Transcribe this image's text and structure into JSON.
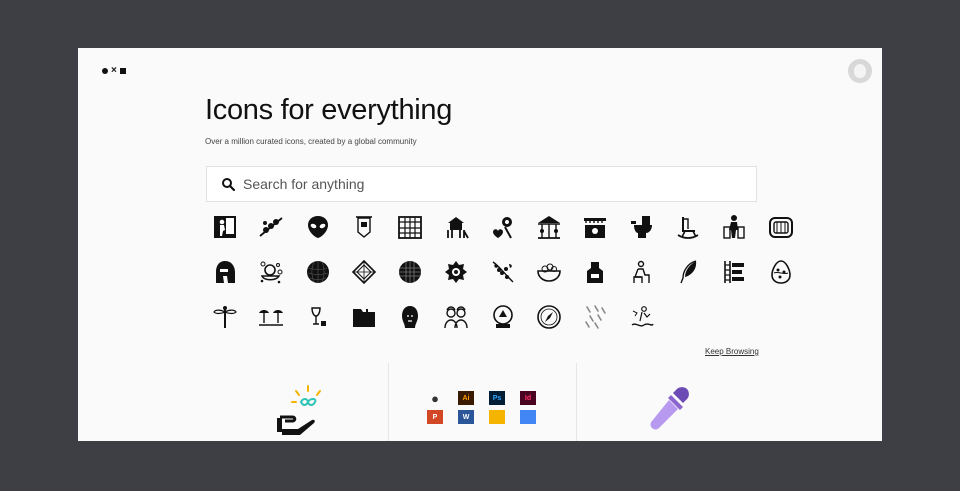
{
  "header": {
    "logo_icon": "dot-times-square-logo",
    "avatar_icon": "user-avatar-icon"
  },
  "hero": {
    "title": "Icons for everything",
    "subtitle": "Over a million curated icons, created by a global community"
  },
  "search": {
    "placeholder": "Search for anything",
    "icon": "search-icon"
  },
  "icon_grid": {
    "rows": [
      [
        "person-doorway-icon",
        "popcorn-kebab-icon",
        "alien-icon",
        "hanging-banner-icon",
        "building-facade-icon",
        "playground-icon",
        "hearts-pin-icon",
        "carousel-icon",
        "shop-stall-icon",
        "toilet-icon",
        "rocking-chair-icon",
        "elder-walker-icon"
      ],
      [
        "hot-tub-icon",
        "spartan-helmet-icon",
        "duck-bubbles-icon",
        "wire-ball-icon",
        "diamond-tile-icon",
        "round-grid-icon",
        "rosette-icon",
        "vine-grapes-icon",
        "fruit-bowl-icon",
        "apron-icon",
        "person-chair-icon",
        "feather-icon"
      ],
      [
        "shelf-ladder-icon",
        "easter-egg-icon",
        "dragonfly-icon",
        "beach-umbrellas-icon",
        "wine-glass-icon",
        "folder-icon",
        "buddha-head-icon",
        "couple-icon",
        "snow-globe-icon",
        "compass-icon",
        "rain-drops-icon",
        "map-person-icon"
      ]
    ]
  },
  "keep_browsing": "Keep Browsing",
  "features": {
    "api_icon": "hand-infinity-icon",
    "integrations": {
      "apps": [
        {
          "name": "apple-icon",
          "label": ""
        },
        {
          "name": "illustrator-icon",
          "label": "Ai"
        },
        {
          "name": "photoshop-icon",
          "label": "Ps"
        },
        {
          "name": "indesign-icon",
          "label": "Id"
        },
        {
          "name": "powerpoint-icon",
          "label": "P"
        },
        {
          "name": "word-icon",
          "label": "W"
        },
        {
          "name": "google-slides-icon",
          "label": ""
        },
        {
          "name": "google-docs-icon",
          "label": ""
        }
      ]
    },
    "recolor_icon": "eyedropper-icon"
  },
  "colors": {
    "background": "#3d3f45",
    "card": "#fafafa",
    "eyedropper": "#8c66cf",
    "infinity": "#2ec4b6",
    "spark": "#f5b400"
  }
}
